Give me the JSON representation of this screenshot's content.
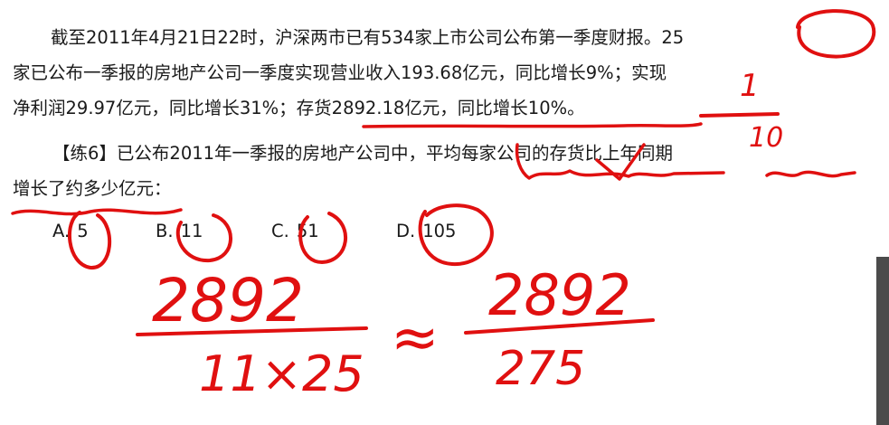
{
  "problem": {
    "line1": "截至2011年4月21日22时，沪深两市已有534家上市公司公布第一季度财报。25",
    "line2": "家已公布一季报的房地产公司一季度实现营业收入193.68亿元，同比增长9%；实现",
    "line3": "净利润29.97亿元，同比增长31%；存货2892.18亿元，同比增长10%。",
    "question_line1": "【练6】已公布2011年一季报的房地产公司中，平均每家公司的存货比上年同期",
    "question_line2": "增长了约多少亿元："
  },
  "options": [
    {
      "letter": "A.",
      "value": "5"
    },
    {
      "letter": "B.",
      "value": "11"
    },
    {
      "letter": "C.",
      "value": "51"
    },
    {
      "letter": "D.",
      "value": "105"
    }
  ],
  "handwriting": {
    "ink_color": "#e01010",
    "fraction_note_top": "1",
    "fraction_note_bottom": "10",
    "left_numerator": "2892",
    "left_denominator": "11×25",
    "approx": "≈",
    "right_numerator": "2892",
    "right_denominator": "275"
  }
}
